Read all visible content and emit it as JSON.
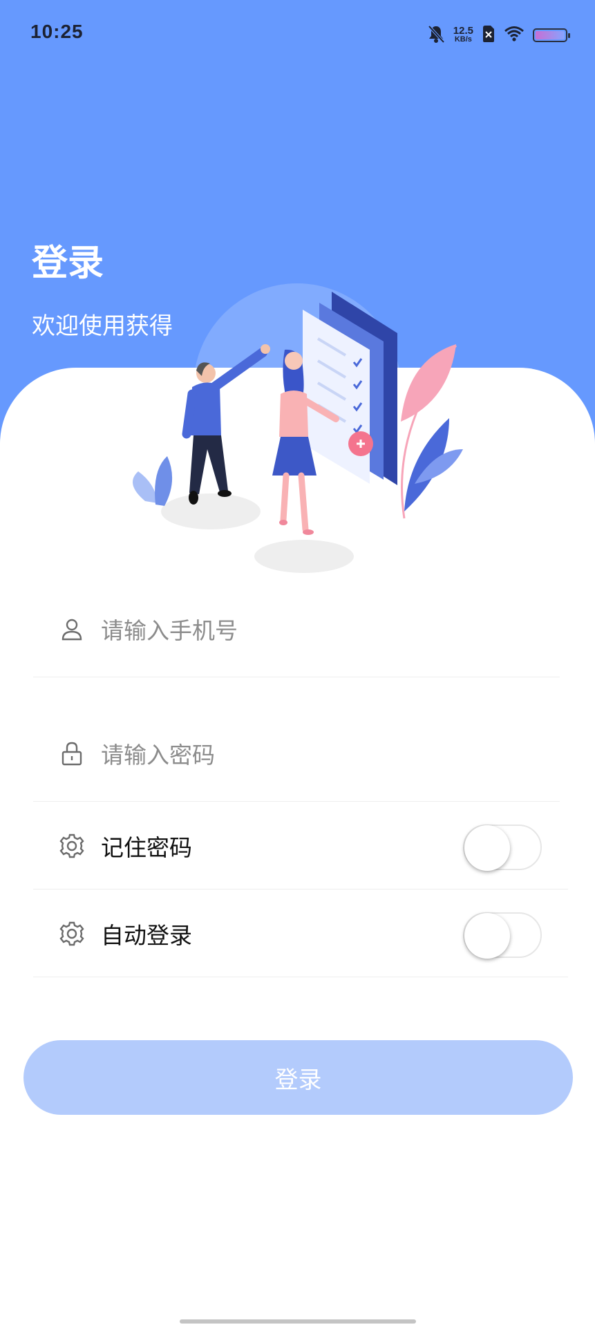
{
  "status_bar": {
    "time": "10:25",
    "net_speed_value": "12.5",
    "net_speed_unit": "KB/s",
    "icons": [
      "bell-off-icon",
      "sim-disabled-icon",
      "wifi-icon",
      "battery-icon"
    ]
  },
  "header": {
    "title": "登录",
    "subtitle": "欢迎使用获得"
  },
  "form": {
    "phone_placeholder": "请输入手机号",
    "password_placeholder": "请输入密码",
    "remember_label": "记住密码",
    "remember_on": false,
    "auto_login_label": "自动登录",
    "auto_login_on": false
  },
  "login_button_label": "登录",
  "colors": {
    "header_bg": "#6699fe",
    "button_bg": "#b3cbfc",
    "illustration_blue": "#4a69d9",
    "illustration_pink": "#f7a5b9"
  }
}
